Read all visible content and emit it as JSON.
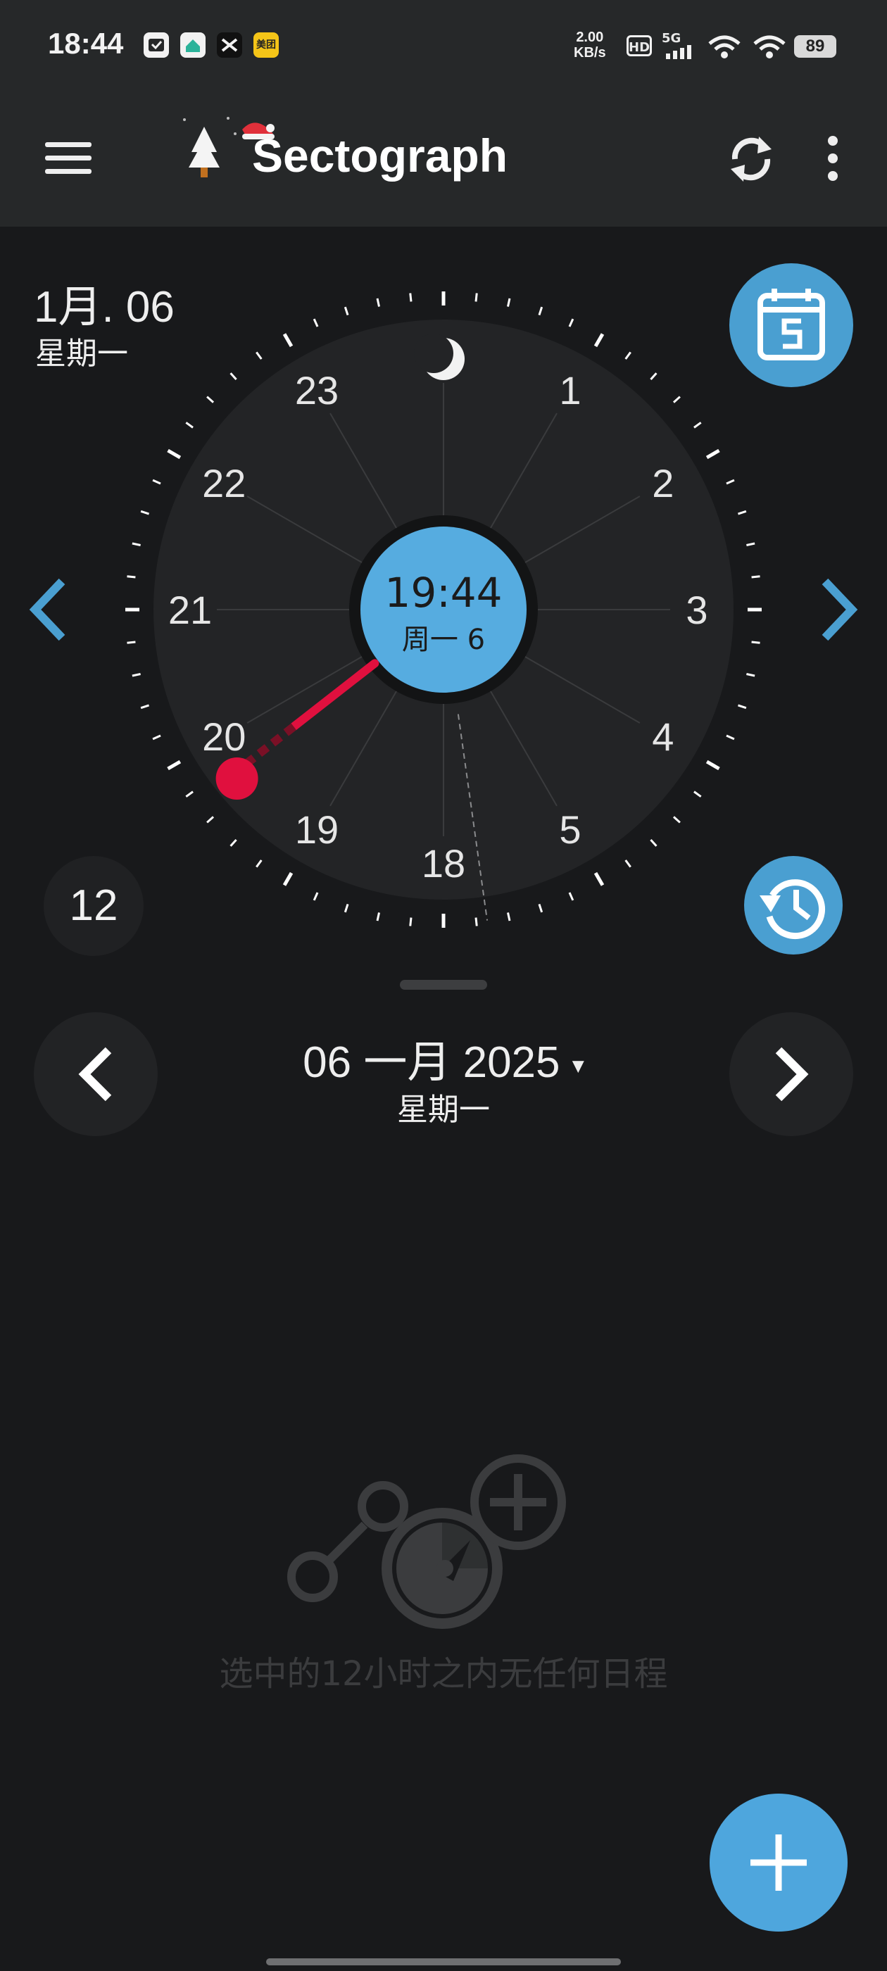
{
  "status_bar": {
    "time": "18:44",
    "net_speed_value": "2.00",
    "net_speed_unit": "KB/s",
    "hd": "HD",
    "network": "5G",
    "battery": "89",
    "app_icons": [
      "notification-icon",
      "home-app-icon",
      "capcut-icon",
      "meituan-icon"
    ],
    "meituan_label": "美团"
  },
  "app_bar": {
    "title": "Sectograph"
  },
  "date_header": {
    "date": "1月. 06",
    "weekday": "星期一"
  },
  "clock": {
    "hour_labels": [
      "18",
      "19",
      "20",
      "21",
      "22",
      "23",
      "1",
      "2",
      "3",
      "4",
      "5"
    ],
    "center_time": "19:44",
    "center_date": "周一 6",
    "current_hour_fraction": 19.733,
    "night_icon": "moon-icon"
  },
  "hours_span_button": "12",
  "day_nav": {
    "month_label": "06 一月 2025",
    "weekday": "星期一",
    "dropdown_icon": "▾"
  },
  "empty_state": {
    "text": "选中的12小时之内无任何日程"
  },
  "colors": {
    "accent": "#4a9fd1",
    "hand": "#e0103e",
    "background": "#18191b",
    "appbar": "#262829"
  }
}
